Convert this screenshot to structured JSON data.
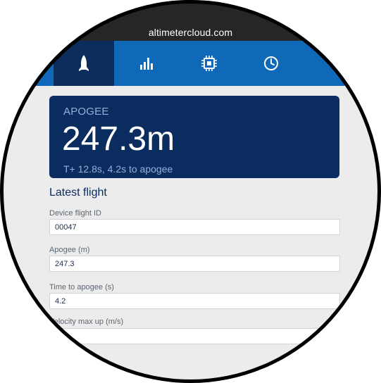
{
  "browser": {
    "url": "altimetercloud.com"
  },
  "nav": {
    "tabs": [
      {
        "icon": "rocket-icon",
        "active": true
      },
      {
        "icon": "bar-chart-icon",
        "active": false
      },
      {
        "icon": "chip-icon",
        "active": false
      },
      {
        "icon": "clock-icon",
        "active": false
      }
    ]
  },
  "apogee_card": {
    "label": "APOGEE",
    "value": "247.3m",
    "subtitle": "T+ 12.8s, 4.2s to apogee"
  },
  "latest_flight": {
    "title": "Latest flight",
    "fields": [
      {
        "label": "Device flight ID",
        "value": "00047"
      },
      {
        "label": "Apogee (m)",
        "value": "247.3"
      },
      {
        "label": "Time to apogee (s)",
        "value": "4.2"
      },
      {
        "label": "Velocity max up (m/s)",
        "value": ""
      }
    ]
  },
  "colors": {
    "url_bar": "#262626",
    "nav_bar": "#1069b8",
    "nav_active": "#0c2d5c",
    "card_bg": "#0b2c5e",
    "page_bg": "#ececec"
  }
}
